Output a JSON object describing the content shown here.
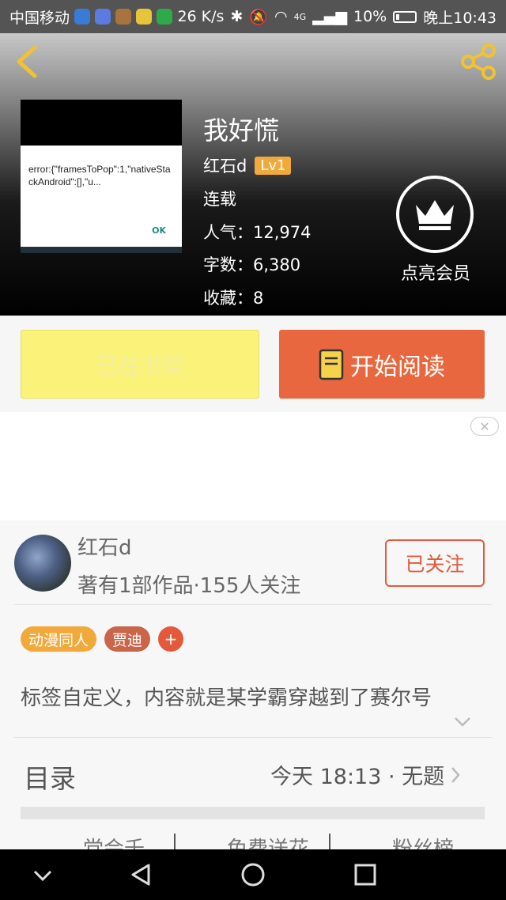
{
  "status_bar": {
    "carrier": "中国移动",
    "speed": "26 K/s",
    "network": "4G",
    "battery": "10%",
    "time": "晚上10:43"
  },
  "header": {
    "back_icon": "chevron-left-icon",
    "share_icon": "share-icon",
    "cover_error_text": "error:{\"framesToPop\":1,\"nativeStackAndroid\":[],\"u...",
    "cover_ok": "OK",
    "title": "我好慌",
    "author": "红石d",
    "level": "Lv1",
    "status": "连载",
    "popularity": "人气：12,974",
    "word_count": "字数：6,380",
    "favorites": "收藏：8",
    "vip_label": "点亮会员",
    "vip_icon": "crown-icon"
  },
  "actions": {
    "shelf_label": "已在书架",
    "read_label": "开始阅读",
    "read_icon": "book-icon"
  },
  "ad": {
    "close_icon": "close-icon"
  },
  "author_section": {
    "name": "红石d",
    "meta": "著有1部作品·155人关注",
    "follow_label": "已关注",
    "tags": [
      {
        "label": "动漫同人",
        "color": "#f2a93b"
      },
      {
        "label": "贾迪",
        "color": "#c9664a"
      }
    ],
    "add_tag": "+",
    "description": "标签自定义，内容就是某学霸穿越到了赛尔号",
    "toc_title": "目录",
    "toc_update": "今天 18:13 · 无题",
    "bottom_tabs": [
      "党会千",
      "免费送花",
      "粉丝榜"
    ]
  },
  "colors": {
    "accent": "#e8673f",
    "shelf_button": "#fbf27a",
    "follow": "#e4593c"
  }
}
